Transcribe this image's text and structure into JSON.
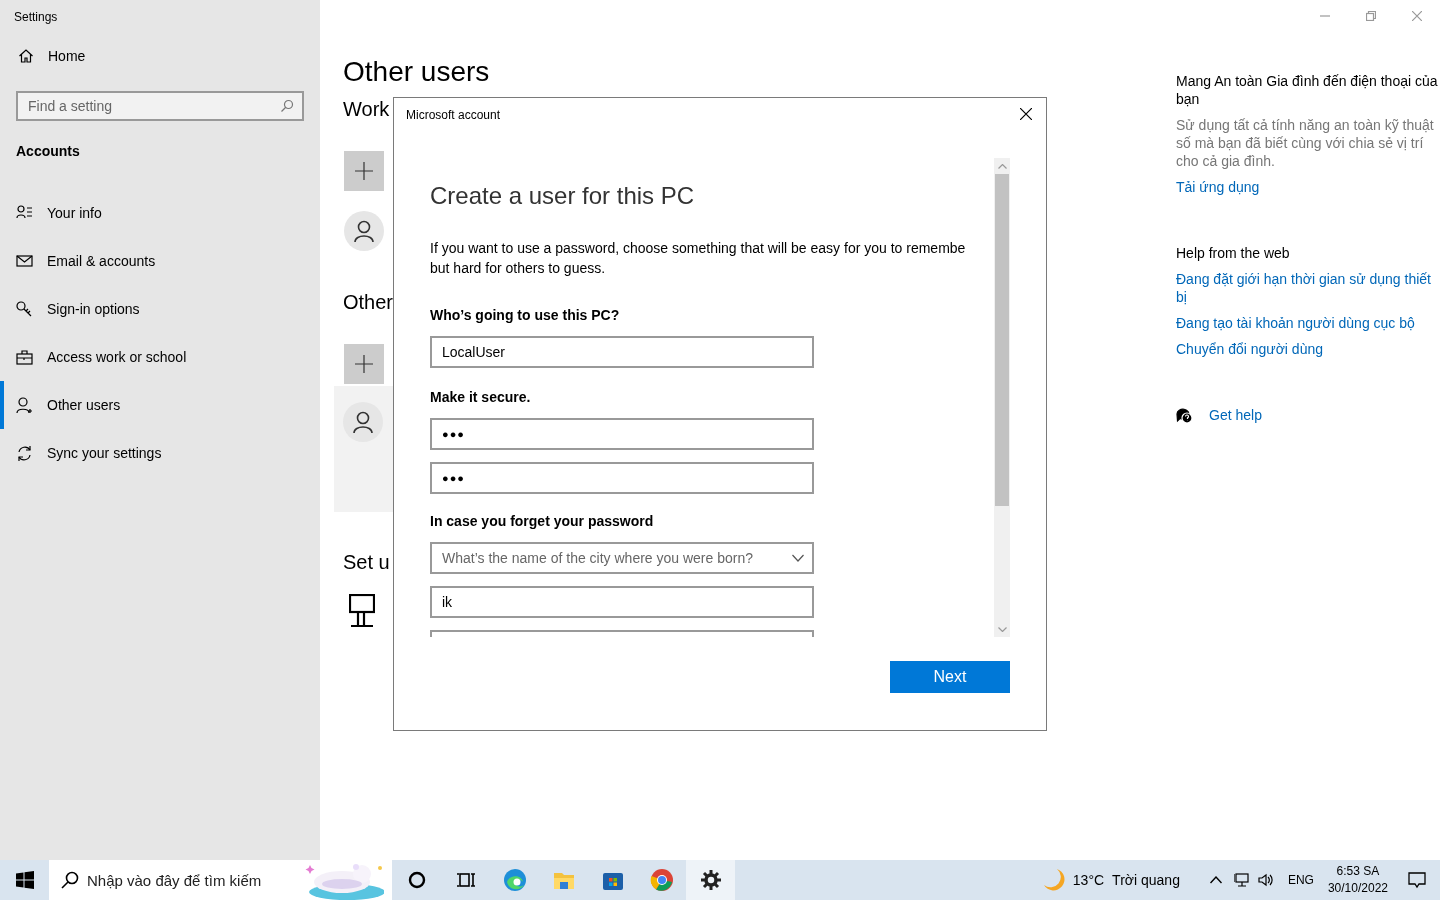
{
  "window": {
    "title": "Settings"
  },
  "sidebar": {
    "home": "Home",
    "search": {
      "placeholder": "Find a setting"
    },
    "section": "Accounts",
    "items": [
      {
        "label": "Your info",
        "selected": false
      },
      {
        "label": "Email & accounts",
        "selected": false
      },
      {
        "label": "Sign-in options",
        "selected": false
      },
      {
        "label": "Access work or school",
        "selected": false
      },
      {
        "label": "Other users",
        "selected": true
      },
      {
        "label": "Sync your settings",
        "selected": false
      }
    ]
  },
  "page": {
    "title": "Other users",
    "headings": [
      "Work",
      "Other",
      "Set u"
    ]
  },
  "right_panel": {
    "family": {
      "title": "Mang An toàn Gia đình đến điện thoại của bạn",
      "description": "Sử dụng tất cả tính năng an toàn kỹ thuật số mà bạn đã biết cùng với chia sẻ vị trí cho cả gia đình.",
      "link": "Tải ứng dụng"
    },
    "help": {
      "title": "Help from the web",
      "links": [
        "Đang đặt giới hạn thời gian sử dụng thiết bị",
        "Đang tạo tài khoản người dùng cục bộ",
        "Chuyển đổi người dùng"
      ]
    },
    "get_help": "Get help"
  },
  "dialog": {
    "title": "Microsoft account",
    "heading": "Create a user for this PC",
    "intro_lines": [
      "If you want to use a password, choose something that will be easy for you to remembe",
      "but hard for others to guess."
    ],
    "name_label": "Who’s going to use this PC?",
    "name_value": "LocalUser",
    "secure_label": "Make it secure.",
    "passwords": [
      "●●●",
      "●●●"
    ],
    "recovery_label": "In case you forget your password",
    "recovery_fields": [
      {
        "kind": "select",
        "placeholder": "What’s the name of the city where you were born?"
      },
      {
        "kind": "text",
        "value": "ik"
      },
      {
        "kind": "text"
      }
    ],
    "next_button": "Next"
  },
  "taskbar": {
    "search": {
      "placeholder": "Nhập vào đây để tìm kiếm"
    },
    "apps": [
      {
        "selected": false
      },
      {
        "selected": false
      },
      {
        "selected": false
      },
      {
        "selected": false
      },
      {
        "selected": false
      },
      {
        "selected": false
      },
      {
        "selected": true
      }
    ],
    "weather": {
      "temperature": "13°C",
      "condition": "Trời quang"
    },
    "language": "ENG",
    "time": "6:53 SA",
    "date": "30/10/2022"
  }
}
